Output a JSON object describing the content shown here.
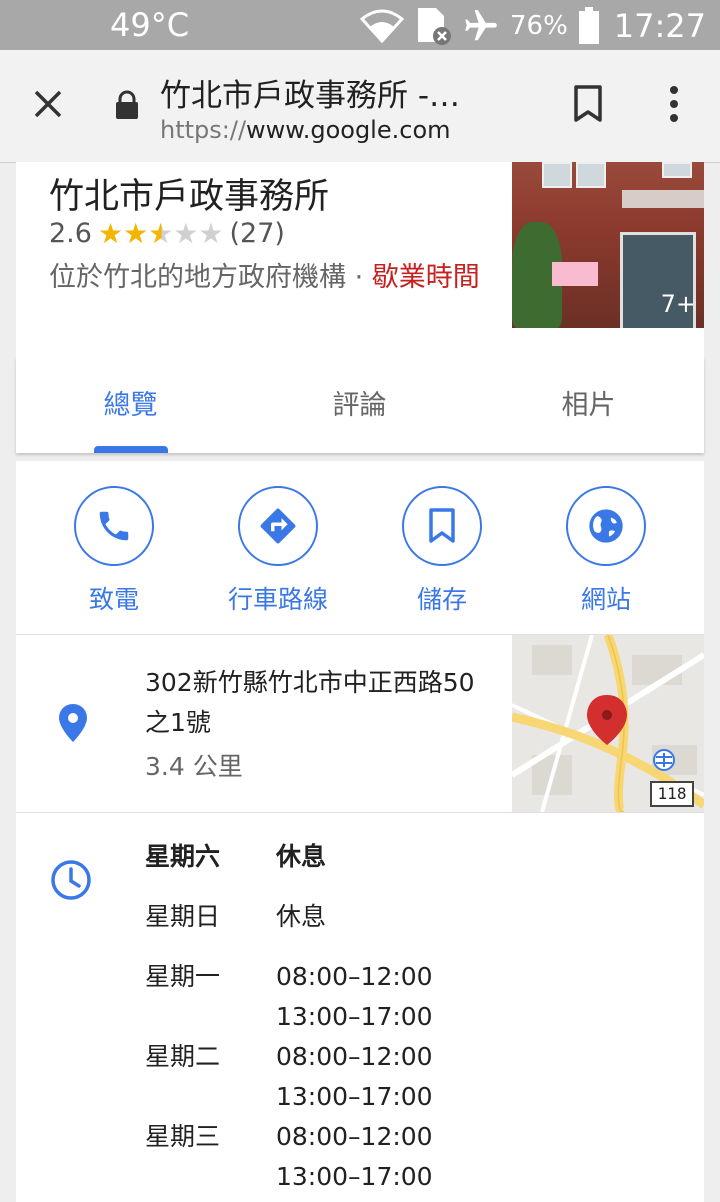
{
  "status_bar": {
    "temperature": "49°C",
    "battery_percent": "76%",
    "time": "17:27",
    "icons": [
      "wifi-icon",
      "sim-error-icon",
      "airplane-icon",
      "battery-icon"
    ]
  },
  "browser": {
    "page_title": "竹北市戶政事務所 -…",
    "url_scheme": "https://",
    "url_host": "www.google.com"
  },
  "place": {
    "name": "竹北市戶政事務所",
    "rating": "2.6",
    "rating_value": 2.6,
    "review_count": "(27)",
    "category": "位於竹北的地方政府機構 · ",
    "hours_link": "歇業時間",
    "photo_count": "7+"
  },
  "tabs": [
    {
      "label": "總覽",
      "active": true
    },
    {
      "label": "評論",
      "active": false
    },
    {
      "label": "相片",
      "active": false
    }
  ],
  "actions": [
    {
      "label": "致電",
      "icon": "phone-icon"
    },
    {
      "label": "行車路線",
      "icon": "directions-icon"
    },
    {
      "label": "儲存",
      "icon": "bookmark-icon"
    },
    {
      "label": "網站",
      "icon": "globe-icon"
    }
  ],
  "address": {
    "text": "302新竹縣竹北市中正西路50之1號",
    "distance": "3.4 公里",
    "map_road_number": "118"
  },
  "hours": [
    {
      "day": "星期六",
      "times": [
        "休息"
      ],
      "today": true
    },
    {
      "day": "星期日",
      "times": [
        "休息"
      ],
      "today": false
    },
    {
      "day": "星期一",
      "times": [
        "08:00–12:00",
        "13:00–17:00"
      ],
      "today": false
    },
    {
      "day": "星期二",
      "times": [
        "08:00–12:00",
        "13:00–17:00"
      ],
      "today": false
    },
    {
      "day": "星期三",
      "times": [
        "08:00–12:00",
        "13:00–17:00"
      ],
      "today": false
    }
  ],
  "colors": {
    "accent": "#3b78e7",
    "star": "#f4b400",
    "hours_link": "#c5221f",
    "map_pin": "#d32f2f"
  }
}
